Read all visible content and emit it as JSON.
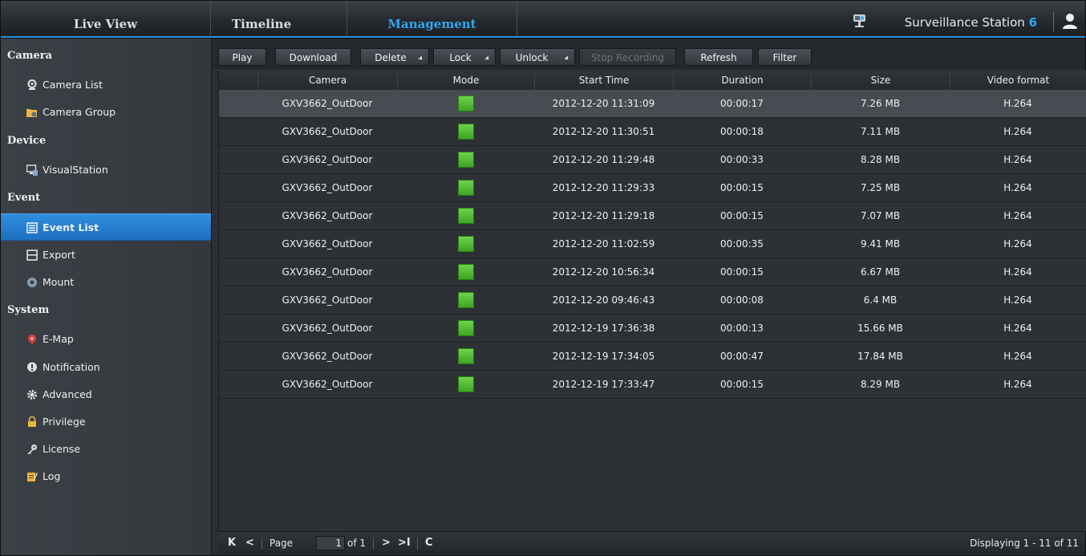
{
  "topbar": {
    "tabs": [
      {
        "label": "Live View"
      },
      {
        "label": "Timeline"
      },
      {
        "label": "Management",
        "active": true
      }
    ],
    "brand_name": "Surveillance Station",
    "brand_version": "6",
    "brand_icon": "camera-icon",
    "user_icon": "user-icon",
    "accent_color": "#2ea7f0"
  },
  "sidebar": {
    "sections": [
      {
        "title": "Camera",
        "items": [
          {
            "label": "Camera List",
            "icon": "camera-icon"
          },
          {
            "label": "Camera Group",
            "icon": "folder-camera-icon"
          }
        ]
      },
      {
        "title": "Device",
        "items": [
          {
            "label": "VisualStation",
            "icon": "monitor-icon"
          }
        ]
      },
      {
        "title": "Event",
        "items": [
          {
            "label": "Event List",
            "icon": "list-icon",
            "active": true
          },
          {
            "label": "Export",
            "icon": "film-icon"
          },
          {
            "label": "Mount",
            "icon": "mount-icon"
          }
        ]
      },
      {
        "title": "System",
        "items": [
          {
            "label": "E-Map",
            "icon": "map-pin-icon"
          },
          {
            "label": "Notification",
            "icon": "notification-icon"
          },
          {
            "label": "Advanced",
            "icon": "gear-icon"
          },
          {
            "label": "Privilege",
            "icon": "lock-icon"
          },
          {
            "label": "License",
            "icon": "key-icon"
          },
          {
            "label": "Log",
            "icon": "log-icon"
          }
        ]
      }
    ]
  },
  "toolbar": {
    "play": "Play",
    "download": "Download",
    "delete": "Delete",
    "lock": "Lock",
    "unlock": "Unlock",
    "stop_recording": "Stop Recording",
    "refresh": "Refresh",
    "filter": "Filter"
  },
  "table": {
    "columns": [
      "Camera",
      "Mode",
      "Start Time",
      "Duration",
      "Size",
      "Video format"
    ],
    "mode_color": "#4cbf2c",
    "rows": [
      {
        "camera": "GXV3662_OutDoor",
        "start": "2012-12-20 11:31:09",
        "duration": "00:00:17",
        "size": "7.26 MB",
        "format": "H.264",
        "selected": true
      },
      {
        "camera": "GXV3662_OutDoor",
        "start": "2012-12-20 11:30:51",
        "duration": "00:00:18",
        "size": "7.11 MB",
        "format": "H.264"
      },
      {
        "camera": "GXV3662_OutDoor",
        "start": "2012-12-20 11:29:48",
        "duration": "00:00:33",
        "size": "8.28 MB",
        "format": "H.264"
      },
      {
        "camera": "GXV3662_OutDoor",
        "start": "2012-12-20 11:29:33",
        "duration": "00:00:15",
        "size": "7.25 MB",
        "format": "H.264"
      },
      {
        "camera": "GXV3662_OutDoor",
        "start": "2012-12-20 11:29:18",
        "duration": "00:00:15",
        "size": "7.07 MB",
        "format": "H.264"
      },
      {
        "camera": "GXV3662_OutDoor",
        "start": "2012-12-20 11:02:59",
        "duration": "00:00:35",
        "size": "9.41 MB",
        "format": "H.264"
      },
      {
        "camera": "GXV3662_OutDoor",
        "start": "2012-12-20 10:56:34",
        "duration": "00:00:15",
        "size": "6.67 MB",
        "format": "H.264"
      },
      {
        "camera": "GXV3662_OutDoor",
        "start": "2012-12-20 09:46:43",
        "duration": "00:00:08",
        "size": "6.4 MB",
        "format": "H.264"
      },
      {
        "camera": "GXV3662_OutDoor",
        "start": "2012-12-19 17:36:38",
        "duration": "00:00:13",
        "size": "15.66 MB",
        "format": "H.264"
      },
      {
        "camera": "GXV3662_OutDoor",
        "start": "2012-12-19 17:34:05",
        "duration": "00:00:47",
        "size": "17.84 MB",
        "format": "H.264"
      },
      {
        "camera": "GXV3662_OutDoor",
        "start": "2012-12-19 17:33:47",
        "duration": "00:00:15",
        "size": "8.29 MB",
        "format": "H.264"
      }
    ]
  },
  "pager": {
    "first": "K",
    "prev": "<",
    "page_label": "Page",
    "page_value": "1",
    "of_label": "of 1",
    "next": ">",
    "last": ">I",
    "refresh": "C",
    "status": "Displaying 1 - 11 of 11"
  }
}
